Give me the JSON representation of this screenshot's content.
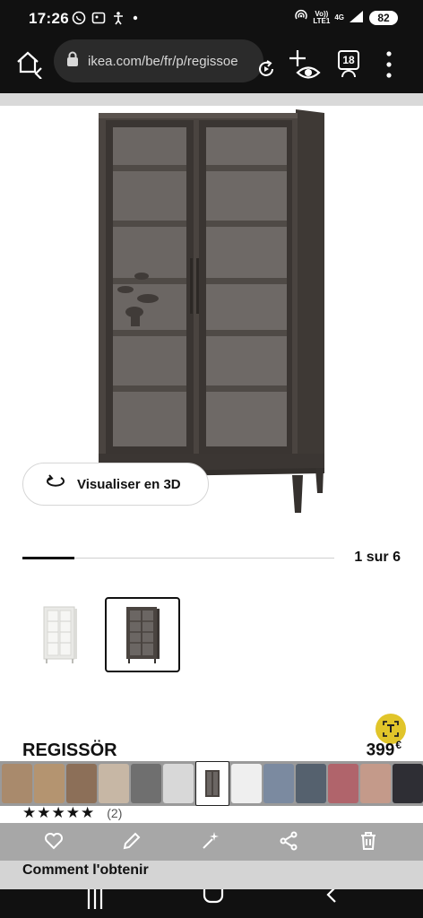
{
  "status_bar": {
    "time": "17:26",
    "network_label_top": "Vo))",
    "network_label_bottom": "LTE1",
    "network_type": "4G",
    "battery": "82"
  },
  "browser": {
    "url": "ikea.com/be/fr/p/regissoe",
    "tab_count": "18"
  },
  "product": {
    "view_3d_label": "Visualiser en 3D",
    "image_counter": "1 sur 6",
    "image_index": 1,
    "image_total": 6,
    "name": "REGISSÖR",
    "price": "399",
    "currency": "€",
    "rating_stars": 5,
    "rating_count": "(2)"
  },
  "availability": {
    "heading": "Comment l'obtenir"
  },
  "colors": {
    "furniture_dark": "#4a4440",
    "accent_lens": "#e1c52a",
    "status_bg": "#111111"
  }
}
